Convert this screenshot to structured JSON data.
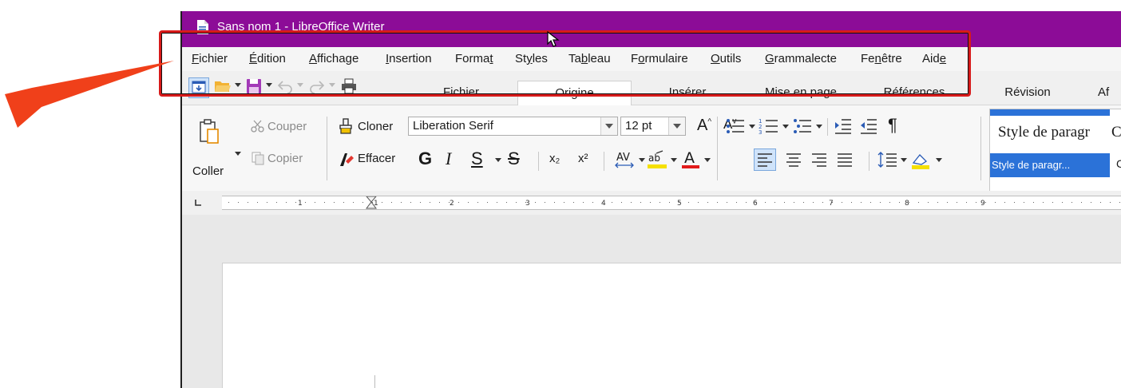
{
  "window": {
    "title": "Sans nom 1 - LibreOffice Writer"
  },
  "menubar": {
    "items": [
      {
        "pre": "",
        "u": "F",
        "post": "ichier"
      },
      {
        "pre": "",
        "u": "É",
        "post": "dition"
      },
      {
        "pre": "",
        "u": "A",
        "post": "ffichage"
      },
      {
        "pre": "",
        "u": "I",
        "post": "nsertion"
      },
      {
        "pre": "Forma",
        "u": "t",
        "post": ""
      },
      {
        "pre": "St",
        "u": "y",
        "post": "les"
      },
      {
        "pre": "Ta",
        "u": "b",
        "post": "leau"
      },
      {
        "pre": "F",
        "u": "o",
        "post": "rmulaire"
      },
      {
        "pre": "",
        "u": "O",
        "post": "utils"
      },
      {
        "pre": "",
        "u": "G",
        "post": "rammalecte"
      },
      {
        "pre": "Fe",
        "u": "n",
        "post": "être"
      },
      {
        "pre": "Aid",
        "u": "e",
        "post": ""
      }
    ]
  },
  "tabs": {
    "items": [
      "Fichier",
      "Origine",
      "Insérer",
      "Mise en page",
      "Références",
      "Révision",
      "Af"
    ],
    "active": "Origine"
  },
  "ribbon": {
    "paste_label": "Coller",
    "cut_label": "Couper",
    "copy_label": "Copier",
    "clone_label": "Cloner",
    "clear_label": "Effacer",
    "font_name": "Liberation Serif",
    "font_size": "12 pt",
    "bold": "G",
    "italic": "I",
    "underline": "S",
    "strike": "S",
    "subscript": "x₂",
    "superscript": "x²",
    "font_color_letter": "A",
    "style_preview": "Style de paragr",
    "style_preview_next": "C",
    "style_selected": "Style de paragr...",
    "style_next_label": "C"
  },
  "ruler": {
    "marks": [
      "1",
      "1",
      "2",
      "3",
      "4",
      "5",
      "6",
      "7",
      "8",
      "9"
    ]
  },
  "colors": {
    "titlebar": "#8c0c97",
    "annotation_red": "#d81a1a",
    "style_blue": "#2b72d8"
  }
}
